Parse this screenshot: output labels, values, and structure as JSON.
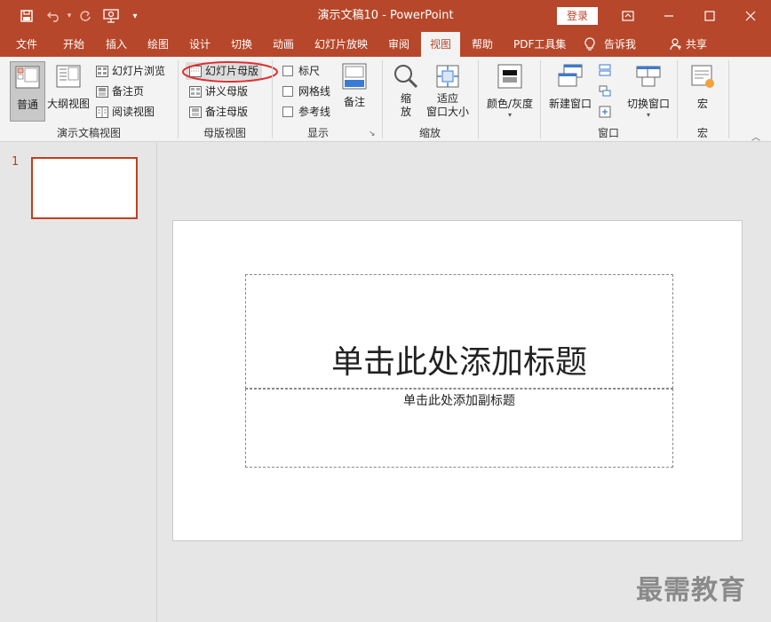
{
  "window": {
    "doc_title": "演示文稿10",
    "separator": "-",
    "app_name": "PowerPoint",
    "login_label": "登录"
  },
  "tabs": [
    {
      "label": "文件"
    },
    {
      "label": "开始"
    },
    {
      "label": "插入"
    },
    {
      "label": "绘图"
    },
    {
      "label": "设计"
    },
    {
      "label": "切换"
    },
    {
      "label": "动画"
    },
    {
      "label": "幻灯片放映"
    },
    {
      "label": "审阅"
    },
    {
      "label": "视图"
    },
    {
      "label": "帮助"
    },
    {
      "label": "PDF工具集"
    },
    {
      "label": "告诉我"
    },
    {
      "label": "共享"
    }
  ],
  "ribbon": {
    "presentation_views": {
      "label": "演示文稿视图",
      "normal": "普通",
      "outline": "大纲视图",
      "slide_sorter": "幻灯片浏览",
      "notes_page": "备注页",
      "reading_view": "阅读视图"
    },
    "master_views": {
      "label": "母版视图",
      "slide_master": "幻灯片母版",
      "handout_master": "讲义母版",
      "notes_master": "备注母版"
    },
    "show": {
      "label": "显示",
      "ruler": "标尺",
      "gridlines": "网格线",
      "guides": "参考线",
      "notes": "备注"
    },
    "zoom": {
      "label": "缩放",
      "zoom_line1": "缩",
      "zoom_line2": "放",
      "fit_line1": "适应",
      "fit_line2": "窗口大小"
    },
    "color": {
      "label": "颜色/灰度"
    },
    "window": {
      "label": "窗口",
      "new_window": "新建窗口",
      "switch_windows": "切换窗口"
    },
    "macros": {
      "label": "宏",
      "macros_btn": "宏"
    }
  },
  "thumbnails": [
    {
      "number": "1"
    }
  ],
  "slide": {
    "title_placeholder": "单击此处添加标题",
    "subtitle_placeholder": "单击此处添加副标题"
  },
  "watermark": "最需教育",
  "colors": {
    "accent": "#b7472a",
    "selection": "#c43e1c",
    "annotation": "#e03030"
  }
}
